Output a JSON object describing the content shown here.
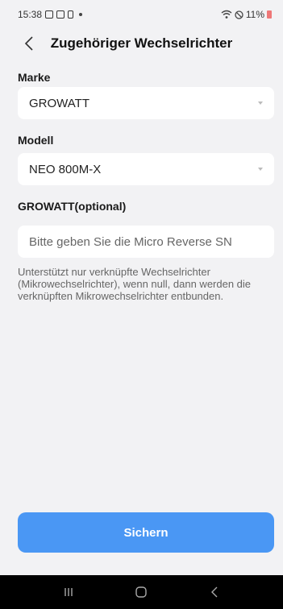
{
  "status_bar": {
    "time": "15:38",
    "battery_text": "11%"
  },
  "header": {
    "title": "Zugehöriger Wechselrichter"
  },
  "form": {
    "brand_label": "Marke",
    "brand_value": "GROWATT",
    "model_label": "Modell",
    "model_value": "NEO 800M-X",
    "sn_label": "GROWATT(optional)",
    "sn_placeholder": "Bitte geben Sie die Micro Reverse SN",
    "sn_value": "",
    "hint": "Unterstützt nur verknüpfte Wechselrichter (Mikrowechselrichter), wenn null, dann werden die verknüpften Mikrowechselrichter entbunden."
  },
  "actions": {
    "save_label": "Sichern"
  },
  "icons": {
    "back": "chevron-left-icon",
    "dropdown": "caret-down-icon",
    "nav_recent": "recent-apps-icon",
    "nav_home": "home-icon",
    "nav_back": "back-icon"
  },
  "colors": {
    "accent": "#4a97f4",
    "background": "#f2f2f4",
    "nav_bar": "#000000"
  }
}
